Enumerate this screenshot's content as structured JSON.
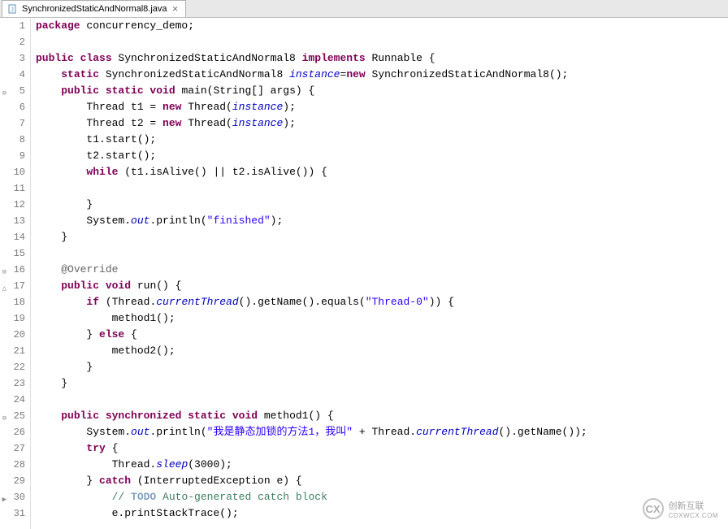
{
  "tab": {
    "filename": "SynchronizedStaticAndNormal8.java",
    "close_glyph": "⨯"
  },
  "code": {
    "lines": [
      {
        "n": 1,
        "marker": "",
        "tokens": [
          [
            "kw",
            "package"
          ],
          [
            "",
            " concurrency_demo;"
          ]
        ]
      },
      {
        "n": 2,
        "marker": "",
        "tokens": [
          [
            "",
            ""
          ]
        ]
      },
      {
        "n": 3,
        "marker": "",
        "tokens": [
          [
            "kw",
            "public class"
          ],
          [
            "",
            " SynchronizedStaticAndNormal8 "
          ],
          [
            "kw",
            "implements"
          ],
          [
            "",
            " Runnable {"
          ]
        ]
      },
      {
        "n": 4,
        "marker": "",
        "tokens": [
          [
            "",
            "    "
          ],
          [
            "kw",
            "static"
          ],
          [
            "",
            " SynchronizedStaticAndNormal8 "
          ],
          [
            "fld",
            "instance"
          ],
          [
            "",
            "="
          ],
          [
            "kw",
            "new"
          ],
          [
            "",
            " SynchronizedStaticAndNormal8();"
          ]
        ]
      },
      {
        "n": 5,
        "marker": "⊖",
        "tokens": [
          [
            "",
            "    "
          ],
          [
            "kw",
            "public static void"
          ],
          [
            "",
            " main(String[] args) {"
          ]
        ]
      },
      {
        "n": 6,
        "marker": "",
        "tokens": [
          [
            "",
            "        Thread t1 = "
          ],
          [
            "kw",
            "new"
          ],
          [
            "",
            " Thread("
          ],
          [
            "fld",
            "instance"
          ],
          [
            "",
            ");"
          ]
        ]
      },
      {
        "n": 7,
        "marker": "",
        "tokens": [
          [
            "",
            "        Thread t2 = "
          ],
          [
            "kw",
            "new"
          ],
          [
            "",
            " Thread("
          ],
          [
            "fld",
            "instance"
          ],
          [
            "",
            ");"
          ]
        ]
      },
      {
        "n": 8,
        "marker": "",
        "tokens": [
          [
            "",
            "        t1.start();"
          ]
        ]
      },
      {
        "n": 9,
        "marker": "",
        "tokens": [
          [
            "",
            "        t2.start();"
          ]
        ]
      },
      {
        "n": 10,
        "marker": "",
        "tokens": [
          [
            "",
            "        "
          ],
          [
            "kw",
            "while"
          ],
          [
            "",
            " (t1.isAlive() || t2.isAlive()) {"
          ]
        ]
      },
      {
        "n": 11,
        "marker": "",
        "tokens": [
          [
            "",
            ""
          ]
        ]
      },
      {
        "n": 12,
        "marker": "",
        "tokens": [
          [
            "",
            "        }"
          ]
        ]
      },
      {
        "n": 13,
        "marker": "",
        "tokens": [
          [
            "",
            "        System."
          ],
          [
            "fld",
            "out"
          ],
          [
            "",
            ".println("
          ],
          [
            "str",
            "\"finished\""
          ],
          [
            "",
            ");"
          ]
        ]
      },
      {
        "n": 14,
        "marker": "",
        "tokens": [
          [
            "",
            "    }"
          ]
        ]
      },
      {
        "n": 15,
        "marker": "",
        "tokens": [
          [
            "",
            ""
          ]
        ]
      },
      {
        "n": 16,
        "marker": "⊖",
        "tokens": [
          [
            "",
            "    "
          ],
          [
            "ann",
            "@Override"
          ]
        ]
      },
      {
        "n": 17,
        "marker": "△",
        "tokens": [
          [
            "",
            "    "
          ],
          [
            "kw",
            "public void"
          ],
          [
            "",
            " run() {"
          ]
        ]
      },
      {
        "n": 18,
        "marker": "",
        "tokens": [
          [
            "",
            "        "
          ],
          [
            "kw",
            "if"
          ],
          [
            "",
            " (Thread."
          ],
          [
            "fld",
            "currentThread"
          ],
          [
            "",
            "().getName().equals("
          ],
          [
            "str",
            "\"Thread-0\""
          ],
          [
            "",
            ")) {"
          ]
        ]
      },
      {
        "n": 19,
        "marker": "",
        "tokens": [
          [
            "",
            "            method1();"
          ]
        ]
      },
      {
        "n": 20,
        "marker": "",
        "tokens": [
          [
            "",
            "        } "
          ],
          [
            "kw",
            "else"
          ],
          [
            "",
            " {"
          ]
        ]
      },
      {
        "n": 21,
        "marker": "",
        "tokens": [
          [
            "",
            "            method2();"
          ]
        ]
      },
      {
        "n": 22,
        "marker": "",
        "tokens": [
          [
            "",
            "        }"
          ]
        ]
      },
      {
        "n": 23,
        "marker": "",
        "tokens": [
          [
            "",
            "    }"
          ]
        ]
      },
      {
        "n": 24,
        "marker": "",
        "tokens": [
          [
            "",
            ""
          ]
        ]
      },
      {
        "n": 25,
        "marker": "⊖",
        "tokens": [
          [
            "",
            "    "
          ],
          [
            "kw",
            "public synchronized static void"
          ],
          [
            "",
            " method1() {"
          ]
        ]
      },
      {
        "n": 26,
        "marker": "",
        "tokens": [
          [
            "",
            "        System."
          ],
          [
            "fld",
            "out"
          ],
          [
            "",
            ".println("
          ],
          [
            "str",
            "\"我是静态加锁的方法1，我叫\""
          ],
          [
            "",
            " + Thread."
          ],
          [
            "fld",
            "currentThread"
          ],
          [
            "",
            "().getName());"
          ]
        ]
      },
      {
        "n": 27,
        "marker": "",
        "tokens": [
          [
            "",
            "        "
          ],
          [
            "kw",
            "try"
          ],
          [
            "",
            " {"
          ]
        ]
      },
      {
        "n": 28,
        "marker": "",
        "tokens": [
          [
            "",
            "            Thread."
          ],
          [
            "fld",
            "sleep"
          ],
          [
            "",
            "(3000);"
          ]
        ]
      },
      {
        "n": 29,
        "marker": "",
        "tokens": [
          [
            "",
            "        } "
          ],
          [
            "kw",
            "catch"
          ],
          [
            "",
            " (InterruptedException e) {"
          ]
        ]
      },
      {
        "n": 30,
        "marker": "▶",
        "tokens": [
          [
            "",
            "            "
          ],
          [
            "com",
            "// "
          ],
          [
            "todo",
            "TODO"
          ],
          [
            "com",
            " Auto-generated catch block"
          ]
        ]
      },
      {
        "n": 31,
        "marker": "",
        "tokens": [
          [
            "",
            "            e.printStackTrace();"
          ]
        ]
      }
    ]
  },
  "watermark": {
    "text1": "创新互联",
    "text2": "CDXWCX.COM",
    "logo": "CX"
  }
}
